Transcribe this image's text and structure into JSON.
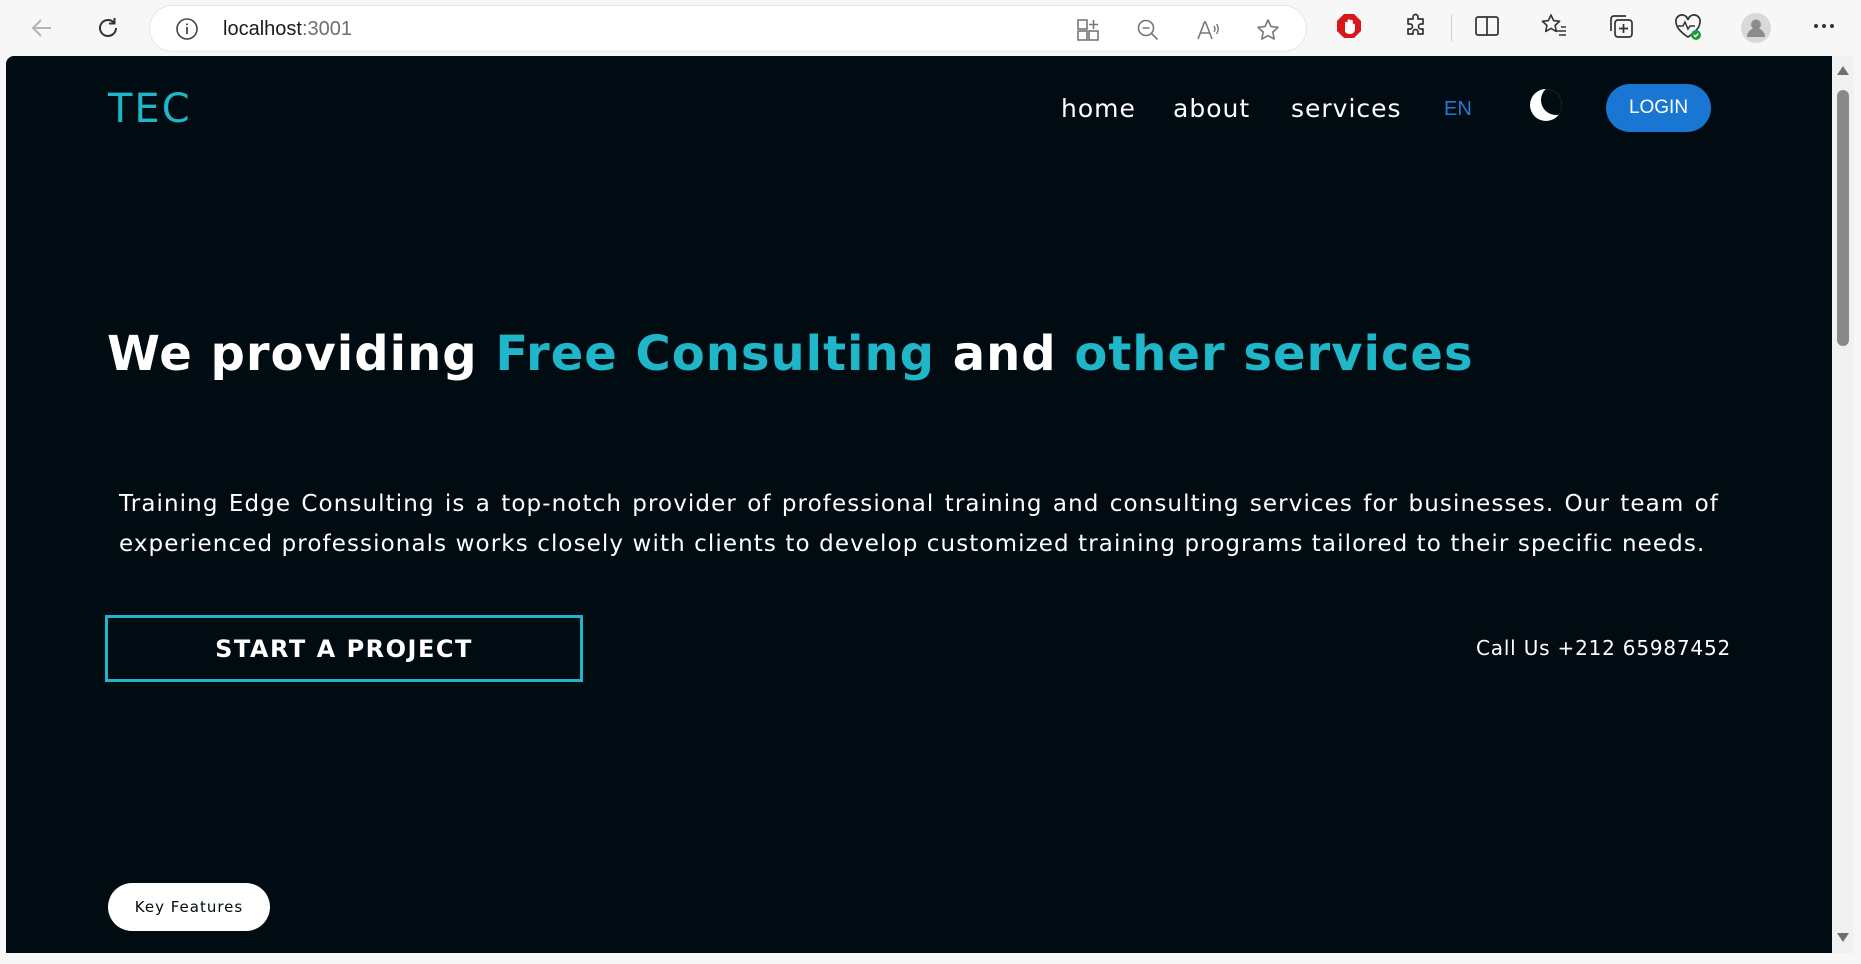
{
  "browser": {
    "url_host": "localhost",
    "url_port": ":3001",
    "icons": {
      "back": "back-arrow-icon",
      "refresh": "refresh-icon",
      "info": "info-icon",
      "apps": "app-available-icon",
      "zoom": "zoom-out-icon",
      "read_aloud": "read-aloud-icon",
      "favorite": "star-icon",
      "adblock": "adblock-icon",
      "extensions": "puzzle-icon",
      "split": "split-screen-icon",
      "favorites": "favorites-icon",
      "collections": "collections-icon",
      "health": "browser-essentials-icon",
      "profile": "profile-icon",
      "more": "more-icon"
    }
  },
  "header": {
    "logo": "TEC",
    "nav": [
      "home",
      "about",
      "services"
    ],
    "language": "EN",
    "theme_icon": "moon-icon",
    "login": "LOGIN"
  },
  "hero": {
    "title_parts": [
      "We providing ",
      "Free Consulting",
      " and ",
      "other services"
    ],
    "description": "Training Edge Consulting is a top-notch provider of professional training and consulting services for businesses. Our team of experienced professionals works closely with clients to develop customized training programs tailored to their specific needs.",
    "cta": "START A PROJECT",
    "call": "Call Us +212 65987452",
    "pill": "Key Features"
  },
  "colors": {
    "background": "#000c11",
    "accent": "#1fb6c9",
    "login": "#1976d2",
    "language": "#1e7bd6"
  }
}
